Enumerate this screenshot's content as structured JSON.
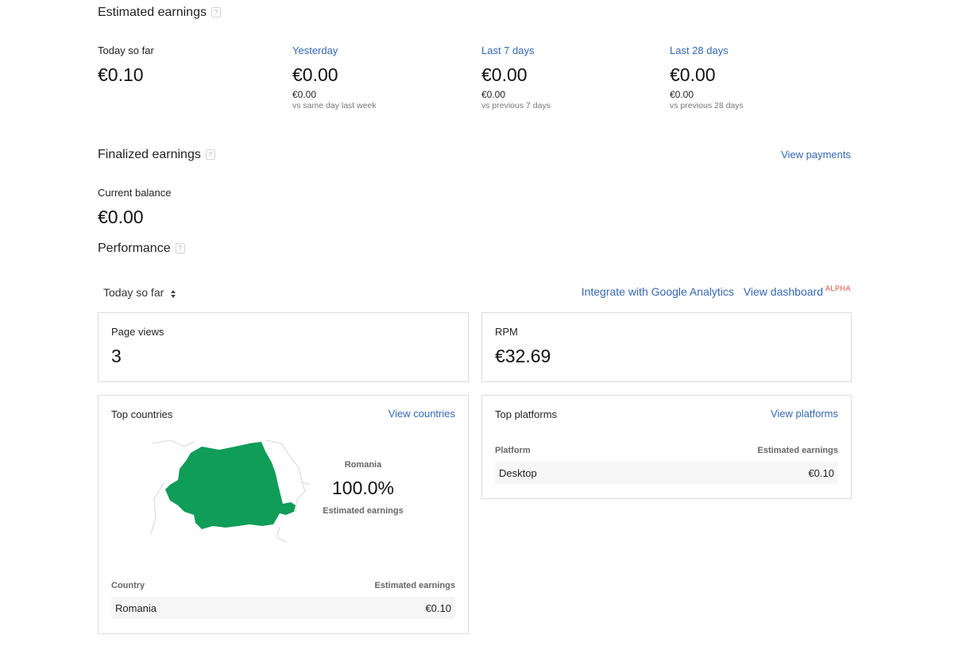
{
  "estimated": {
    "title": "Estimated earnings",
    "help": "?",
    "periods": [
      {
        "label": "Today so far",
        "value": "€0.10",
        "compare_value": "",
        "compare_text": ""
      },
      {
        "label": "Yesterday",
        "value": "€0.00",
        "compare_value": "€0.00",
        "compare_text": "vs same day last week"
      },
      {
        "label": "Last 7 days",
        "value": "€0.00",
        "compare_value": "€0.00",
        "compare_text": "vs previous 7 days"
      },
      {
        "label": "Last 28 days",
        "value": "€0.00",
        "compare_value": "€0.00",
        "compare_text": "vs previous 28 days"
      }
    ]
  },
  "finalized": {
    "title": "Finalized earnings",
    "help": "?",
    "view_payments": "View payments",
    "balance_label": "Current balance",
    "balance_value": "€0.00"
  },
  "performance": {
    "title": "Performance",
    "help": "?",
    "range_selector": "Today so far",
    "integrate_link": "Integrate with Google Analytics",
    "dashboard_link": "View dashboard",
    "dashboard_badge": "ALPHA",
    "page_views": {
      "label": "Page views",
      "value": "3"
    },
    "rpm": {
      "label": "RPM",
      "value": "€32.69"
    }
  },
  "top_countries": {
    "title": "Top countries",
    "view_link": "View countries",
    "map_country": "Romania",
    "map_percent": "100.0%",
    "map_metric": "Estimated earnings",
    "map_fill_color": "#0f9d58",
    "columns": [
      "Country",
      "Estimated earnings"
    ],
    "rows": [
      {
        "name": "Romania",
        "value": "€0.10"
      }
    ]
  },
  "top_platforms": {
    "title": "Top platforms",
    "view_link": "View platforms",
    "columns": [
      "Platform",
      "Estimated earnings"
    ],
    "rows": [
      {
        "name": "Desktop",
        "value": "€0.10"
      }
    ]
  },
  "colors": {
    "link": "#3367b7",
    "accent_map": "#0f9d58",
    "alpha_badge": "#dd4b39"
  }
}
